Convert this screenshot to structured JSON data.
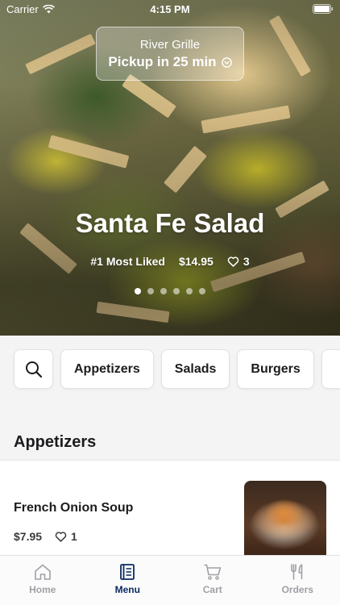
{
  "status_bar": {
    "carrier": "Carrier",
    "time": "4:15 PM"
  },
  "location": {
    "name": "River Grille",
    "pickup": "Pickup in 25 min"
  },
  "featured": {
    "title": "Santa Fe Salad",
    "badge": "#1 Most Liked",
    "price": "$14.95",
    "likes": "3",
    "page_count": 6,
    "active_page": 1
  },
  "categories": [
    "Appetizers",
    "Salads",
    "Burgers"
  ],
  "menu": {
    "section_title": "Appetizers",
    "items": [
      {
        "name": "French Onion Soup",
        "price": "$7.95",
        "likes": "1"
      }
    ]
  },
  "tabs": [
    {
      "label": "Home",
      "icon": "home-icon"
    },
    {
      "label": "Menu",
      "icon": "menu-icon"
    },
    {
      "label": "Cart",
      "icon": "cart-icon"
    },
    {
      "label": "Orders",
      "icon": "orders-icon"
    }
  ],
  "active_tab": "Menu",
  "colors": {
    "accent": "#0c2a60",
    "inactive_tab": "#a0a0a5"
  }
}
